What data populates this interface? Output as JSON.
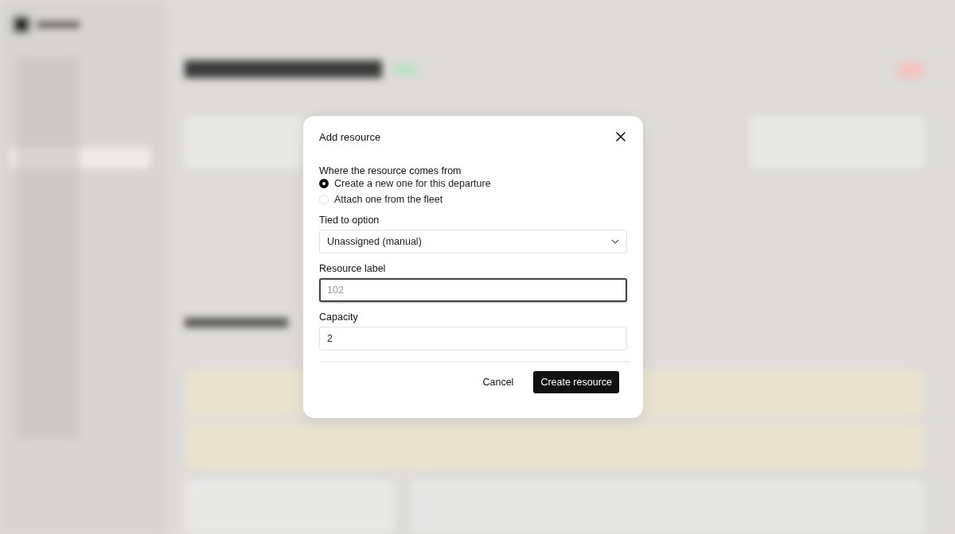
{
  "dialog": {
    "title": "Add resource",
    "source": {
      "label": "Where the resource comes from",
      "options": [
        {
          "label": "Create a new one for this departure",
          "selected": true
        },
        {
          "label": "Attach one from the fleet",
          "selected": false
        }
      ]
    },
    "tied_to": {
      "label": "Tied to option",
      "value": "Unassigned (manual)"
    },
    "resource_label": {
      "label": "Resource label",
      "placeholder": "102",
      "focused": true
    },
    "capacity": {
      "label": "Capacity",
      "value": "2"
    },
    "buttons": [
      {
        "label": "Cancel",
        "kind": "secondary"
      },
      {
        "label": "Create resource",
        "kind": "primary"
      }
    ]
  }
}
